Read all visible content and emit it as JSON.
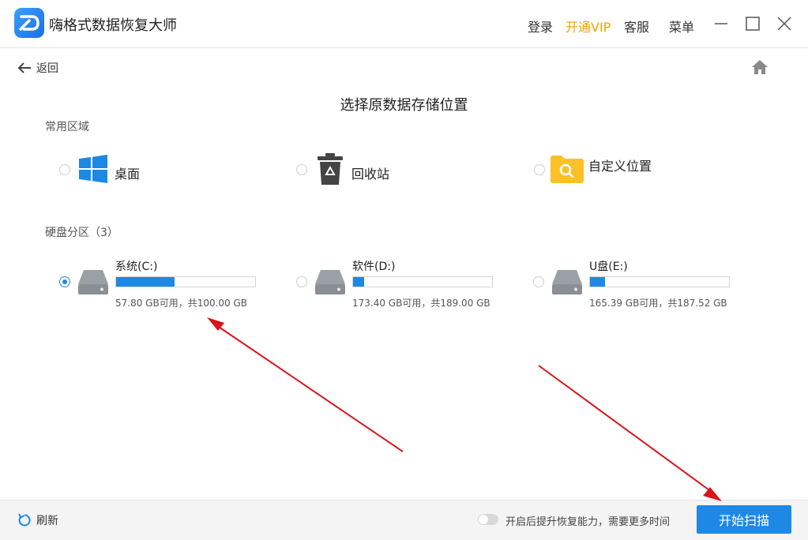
{
  "app": {
    "title": "嗨格式数据恢复大师"
  },
  "titlebar": {
    "login": "登录",
    "vip": "开通VIP",
    "service": "客服",
    "menu": "菜单"
  },
  "nav": {
    "back_label": "返回"
  },
  "page": {
    "title": "选择原数据存储位置"
  },
  "common_area": {
    "label": "常用区域",
    "options": [
      {
        "label": "桌面",
        "icon": "windows-icon",
        "selected": false
      },
      {
        "label": "回收站",
        "icon": "recycle-bin-icon",
        "selected": false
      },
      {
        "label": "自定义位置",
        "icon": "folder-search-icon",
        "selected": false
      }
    ]
  },
  "partitions": {
    "label": "硬盘分区（3）",
    "drives": [
      {
        "name": "系统(C:)",
        "info": "57.80 GB可用，共100.00 GB",
        "used_fraction": 0.42,
        "selected": true
      },
      {
        "name": "软件(D:)",
        "info": "173.40 GB可用，共189.00 GB",
        "used_fraction": 0.08,
        "selected": false
      },
      {
        "name": "U盘(E:)",
        "info": "165.39 GB可用，共187.52 GB",
        "used_fraction": 0.11,
        "selected": false
      }
    ]
  },
  "footer": {
    "refresh_label": "刷新",
    "toggle_label": "开启后提升恢复能力，需要更多时间",
    "toggle_on": false,
    "scan_button": "开始扫描"
  },
  "colors": {
    "accent": "#1e88e5",
    "vip": "#f5a100",
    "annotation_arrow": "#d9141b"
  }
}
